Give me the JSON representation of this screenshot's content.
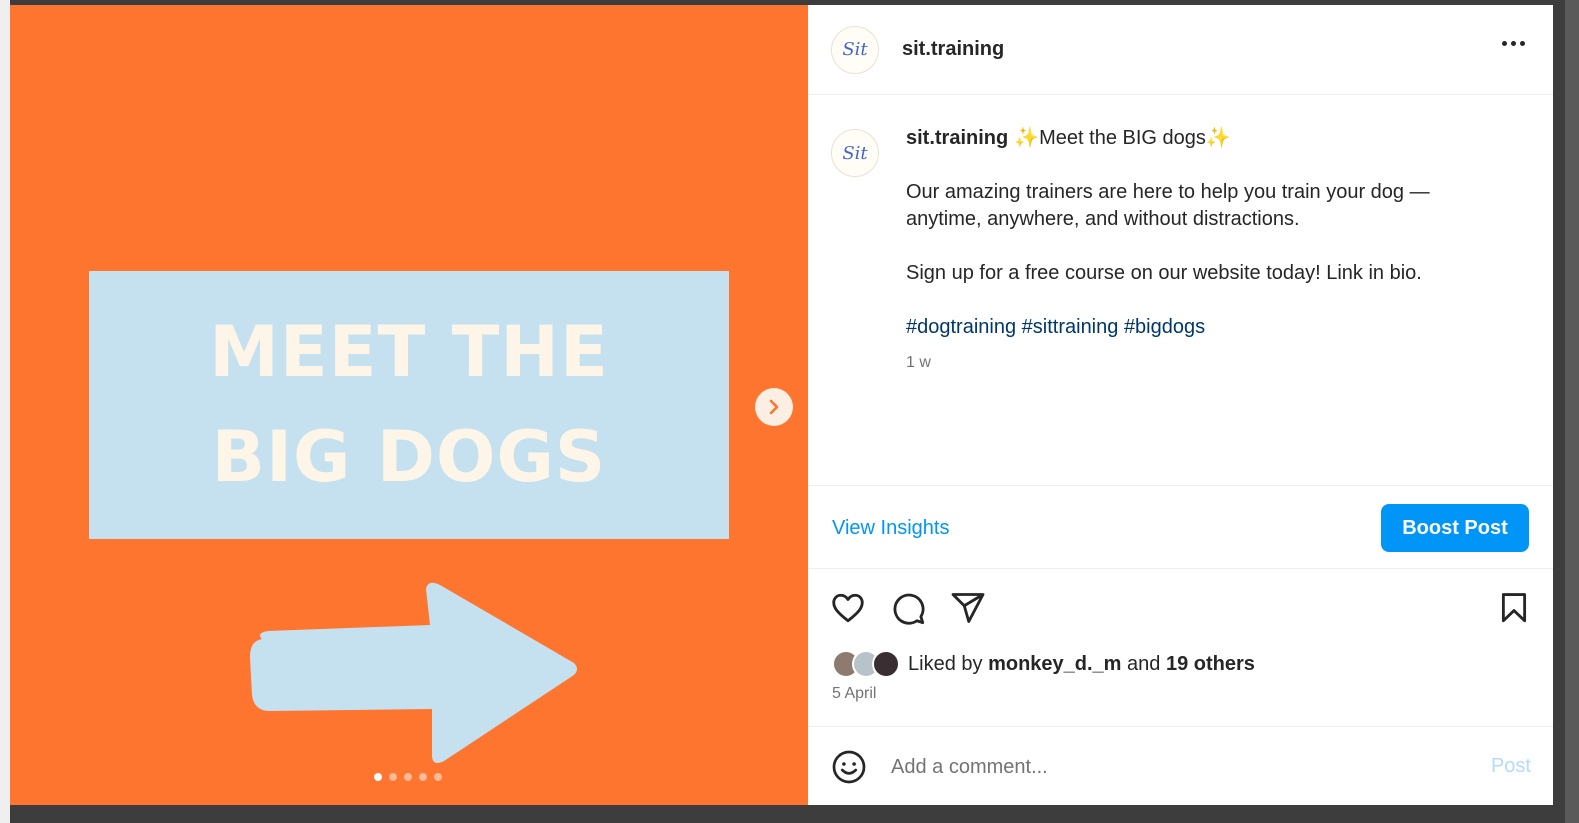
{
  "post": {
    "username": "sit.training",
    "avatar_text": "Sit",
    "more_icon": "more-horizontal-icon"
  },
  "media": {
    "banner_line1": "MEET THE",
    "banner_line2": "BIG DOGS",
    "background_color": "#fd752f",
    "banner_color": "#c5e1ef",
    "slide_count": 5,
    "active_slide": 1
  },
  "caption": {
    "username": "sit.training",
    "headline": "✨Meet the BIG dogs✨",
    "paragraph1": "Our amazing trainers are here to help you train your dog — anytime, anywhere, and without distractions.",
    "paragraph2": "Sign up for a free course on our website today! Link in bio.",
    "hashtags": [
      "#dogtraining",
      "#sittraining",
      "#bigdogs"
    ],
    "time_ago": "1 w"
  },
  "insights": {
    "view_label": "View Insights",
    "boost_label": "Boost Post",
    "accent": "#0095f6"
  },
  "engagement": {
    "liked_by_prefix": "Liked by",
    "liked_by_user": "monkey_d._m",
    "and": "and",
    "others": "19 others",
    "date": "5 April"
  },
  "comment": {
    "placeholder": "Add a comment...",
    "post_label": "Post"
  }
}
